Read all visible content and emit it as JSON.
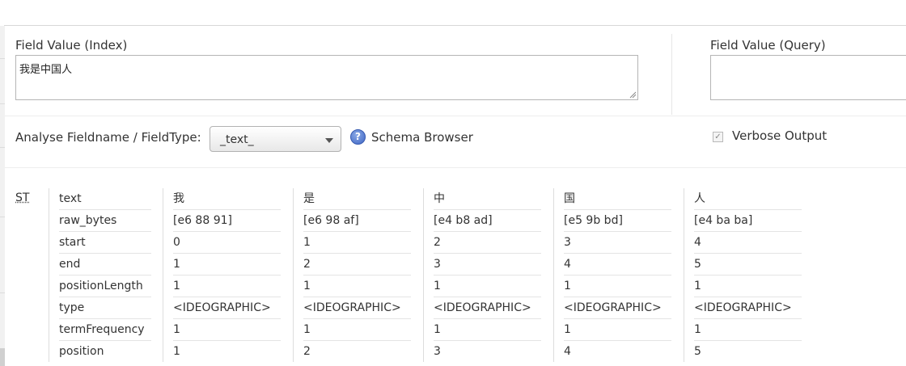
{
  "index_field": {
    "label": "Field Value (Index)",
    "value": "我是中国人"
  },
  "query_field": {
    "label": "Field Value (Query)",
    "value": ""
  },
  "analyse": {
    "label": "Analyse Fieldname / FieldType:",
    "selected": "_text_",
    "schema_browser": "Schema Browser",
    "help_icon": "?"
  },
  "verbose": {
    "label": "Verbose Output",
    "checked": true
  },
  "result": {
    "stage": "ST",
    "row_labels": [
      "text",
      "raw_bytes",
      "start",
      "end",
      "positionLength",
      "type",
      "termFrequency",
      "position"
    ],
    "tokens": [
      [
        "我",
        "[e6 88 91]",
        "0",
        "1",
        "1",
        "<IDEOGRAPHIC>",
        "1",
        "1"
      ],
      [
        "是",
        "[e6 98 af]",
        "1",
        "2",
        "1",
        "<IDEOGRAPHIC>",
        "1",
        "2"
      ],
      [
        "中",
        "[e4 b8 ad]",
        "2",
        "3",
        "1",
        "<IDEOGRAPHIC>",
        "1",
        "3"
      ],
      [
        "国",
        "[e5 9b bd]",
        "3",
        "4",
        "1",
        "<IDEOGRAPHIC>",
        "1",
        "4"
      ],
      [
        "人",
        "[e4 ba ba]",
        "4",
        "5",
        "1",
        "<IDEOGRAPHIC>",
        "1",
        "5"
      ]
    ]
  }
}
